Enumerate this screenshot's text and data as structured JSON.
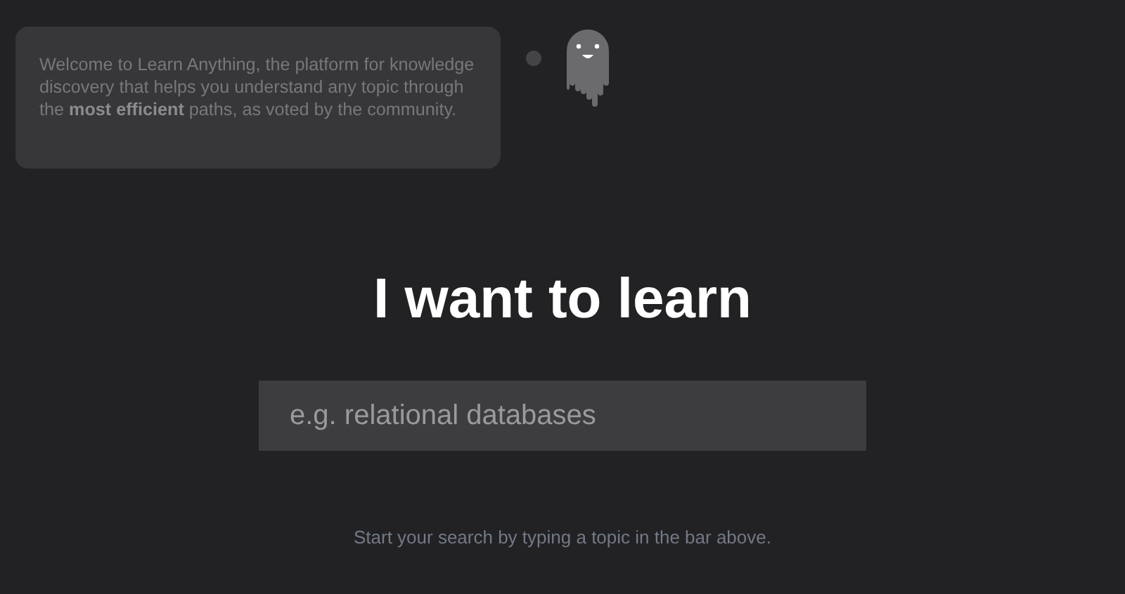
{
  "welcome": {
    "text": "Welcome to Learn Anything, the platform for knowledge discovery that helps you understand any topic through the **most efficient** paths, as voted by the community."
  },
  "heading": "I want to learn",
  "search": {
    "placeholder": "e.g. relational databases"
  },
  "hint": "Start your search by typing a topic in the bar above."
}
